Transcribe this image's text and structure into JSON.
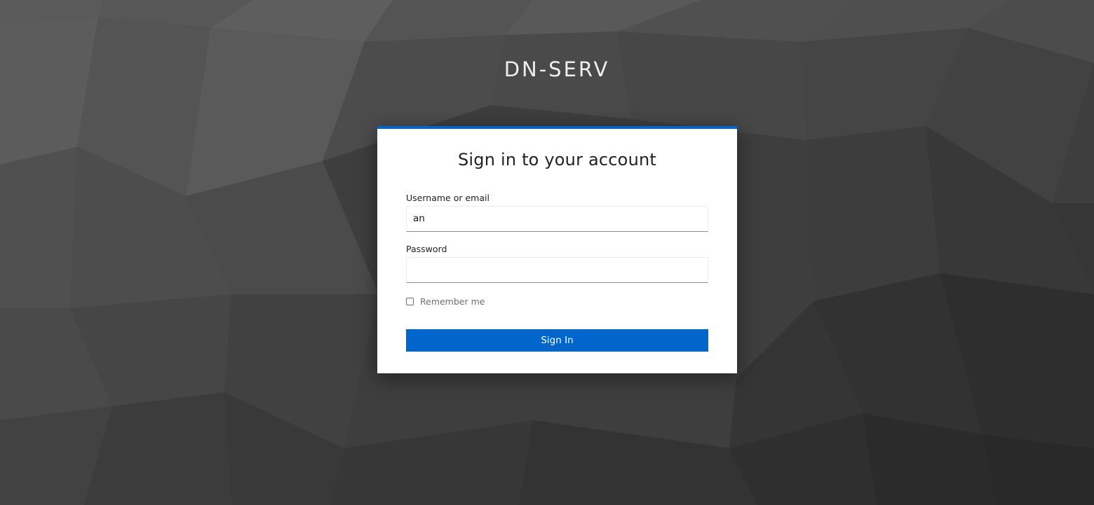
{
  "realm": {
    "title": "DN-SERV"
  },
  "login": {
    "heading": "Sign in to your account",
    "username": {
      "label": "Username or email",
      "value": "an"
    },
    "password": {
      "label": "Password",
      "value": ""
    },
    "remember_me": {
      "label": "Remember me",
      "checked": false
    },
    "submit_label": "Sign In"
  },
  "colors": {
    "accent": "#0066cc",
    "background": "#3a3a3a",
    "card": "#ffffff"
  }
}
